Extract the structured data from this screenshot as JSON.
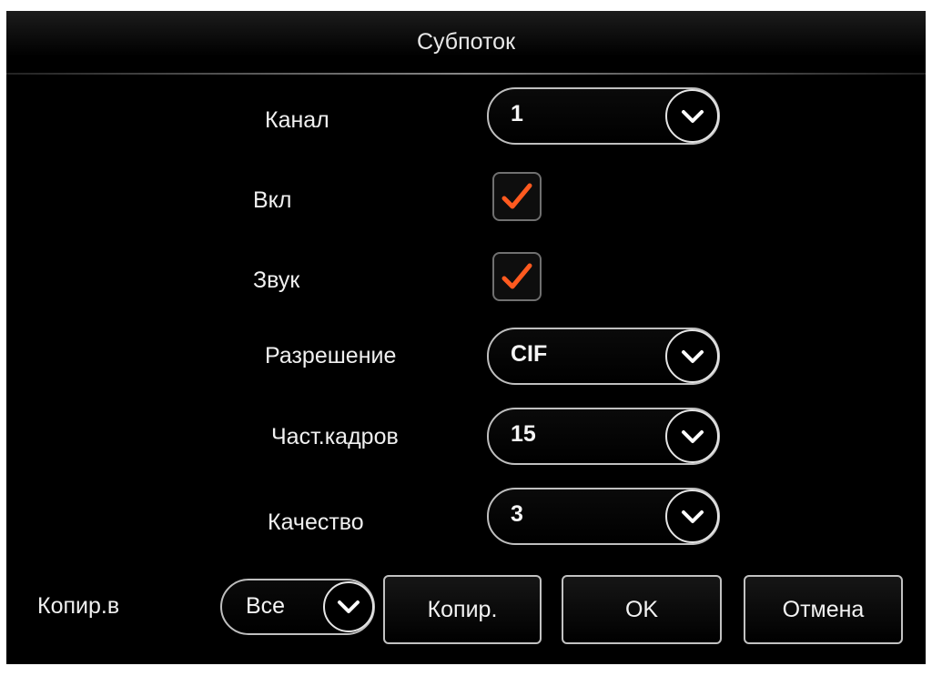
{
  "window": {
    "title": "Субпоток"
  },
  "form": {
    "channel": {
      "label": "Канал",
      "value": "1"
    },
    "enable": {
      "label": "Вкл",
      "checked": true
    },
    "audio": {
      "label": "Звук",
      "checked": true
    },
    "resolution": {
      "label": "Разрешение",
      "value": "CIF"
    },
    "frame_rate": {
      "label": "Част.кадров",
      "value": "15"
    },
    "quality": {
      "label": "Качество",
      "value": "3"
    }
  },
  "footer": {
    "copy_to_label": "Копир.в",
    "copy_to_value": "Все",
    "copy_button": "Копир.",
    "ok_button": "OK",
    "cancel_button": "Отмена"
  },
  "colors": {
    "background": "#000000",
    "checkmark": "#ff5a1f",
    "border": "#bfbfbf"
  },
  "icons": {
    "dropdown": "chevron-down-icon",
    "checkbox": "checkmark-icon"
  }
}
